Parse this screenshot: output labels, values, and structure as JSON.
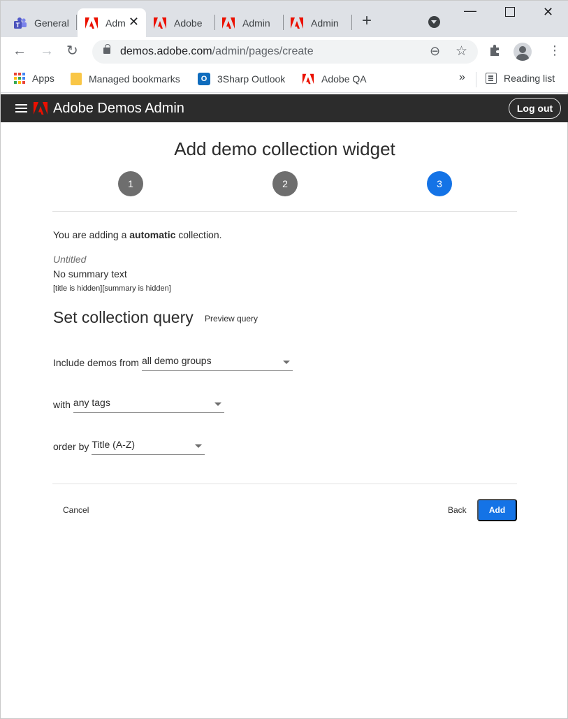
{
  "browser": {
    "tabs": [
      {
        "title": "General",
        "icon": "teams-icon",
        "active": false
      },
      {
        "title": "Admin",
        "icon": "adobe-icon",
        "active": true
      },
      {
        "title": "Adobe",
        "icon": "adobe-icon",
        "active": false
      },
      {
        "title": "Admin",
        "icon": "adobe-icon",
        "active": false
      },
      {
        "title": "Admin",
        "icon": "adobe-icon",
        "active": false
      }
    ],
    "url_host": "demos.adobe.com",
    "url_path": "/admin/pages/create",
    "bookmarks": [
      {
        "label": "Apps",
        "icon": "apps-grid-icon"
      },
      {
        "label": "Managed bookmarks",
        "icon": "folder-icon"
      },
      {
        "label": "3Sharp Outlook",
        "icon": "outlook-icon"
      },
      {
        "label": "Adobe QA",
        "icon": "adobe-icon"
      }
    ],
    "reading_list": "Reading list"
  },
  "header": {
    "title": "Adobe Demos Admin",
    "logout_label": "Log out"
  },
  "main": {
    "title": "Add demo collection widget",
    "steps": [
      {
        "label": "1",
        "state": "done"
      },
      {
        "label": "2",
        "state": "done"
      },
      {
        "label": "3",
        "state": "current"
      }
    ],
    "adding_prefix": "You are adding a ",
    "adding_type": "automatic",
    "adding_suffix": " collection.",
    "collection_title": "Untitled",
    "summary": "No summary text",
    "hidden_note": "[title is hidden][summary is hidden]",
    "section_title": "Set collection query",
    "preview_link": "Preview query",
    "query": {
      "groups_label": "Include demos from",
      "groups_value": "all demo groups",
      "tags_label": "with",
      "tags_value": "any tags",
      "order_label": "order by",
      "order_value": "Title (A-Z)"
    },
    "cancel_label": "Cancel",
    "back_label": "Back",
    "add_label": "Add"
  },
  "colors": {
    "accent": "#1473e6",
    "appbar": "#2c2c2c",
    "adobe_red": "#eb1000"
  }
}
